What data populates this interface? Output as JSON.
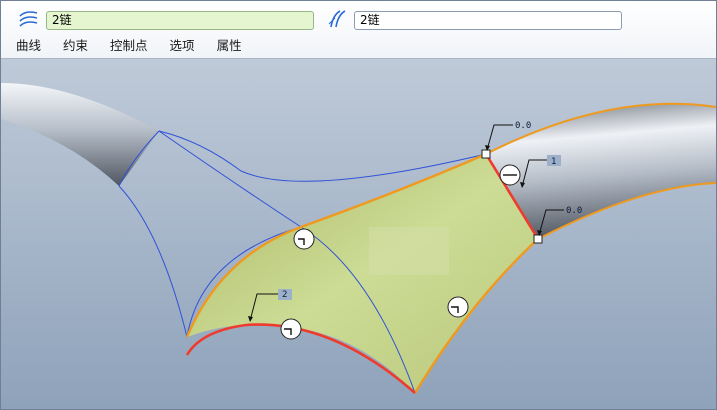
{
  "references": {
    "first_value": "2链",
    "first_icon": "curve-reference-icon",
    "second_value": "2链",
    "second_icon": "tangent-curve-icon"
  },
  "menu": {
    "items": [
      "曲线",
      "约束",
      "控制点",
      "选项",
      "属性"
    ]
  },
  "graphics": {
    "dimension_labels": {
      "top_right_a": "0.0",
      "top_right_b": "1",
      "right_mid": "0.0",
      "left_bottom": "2"
    },
    "colors": {
      "surface": "#c9d88f",
      "boundary_orange": "#ef9a1e",
      "boundary_red": "#ee3b2d",
      "construction_blue": "#2f52d6",
      "background": "#a9b8cb"
    }
  }
}
